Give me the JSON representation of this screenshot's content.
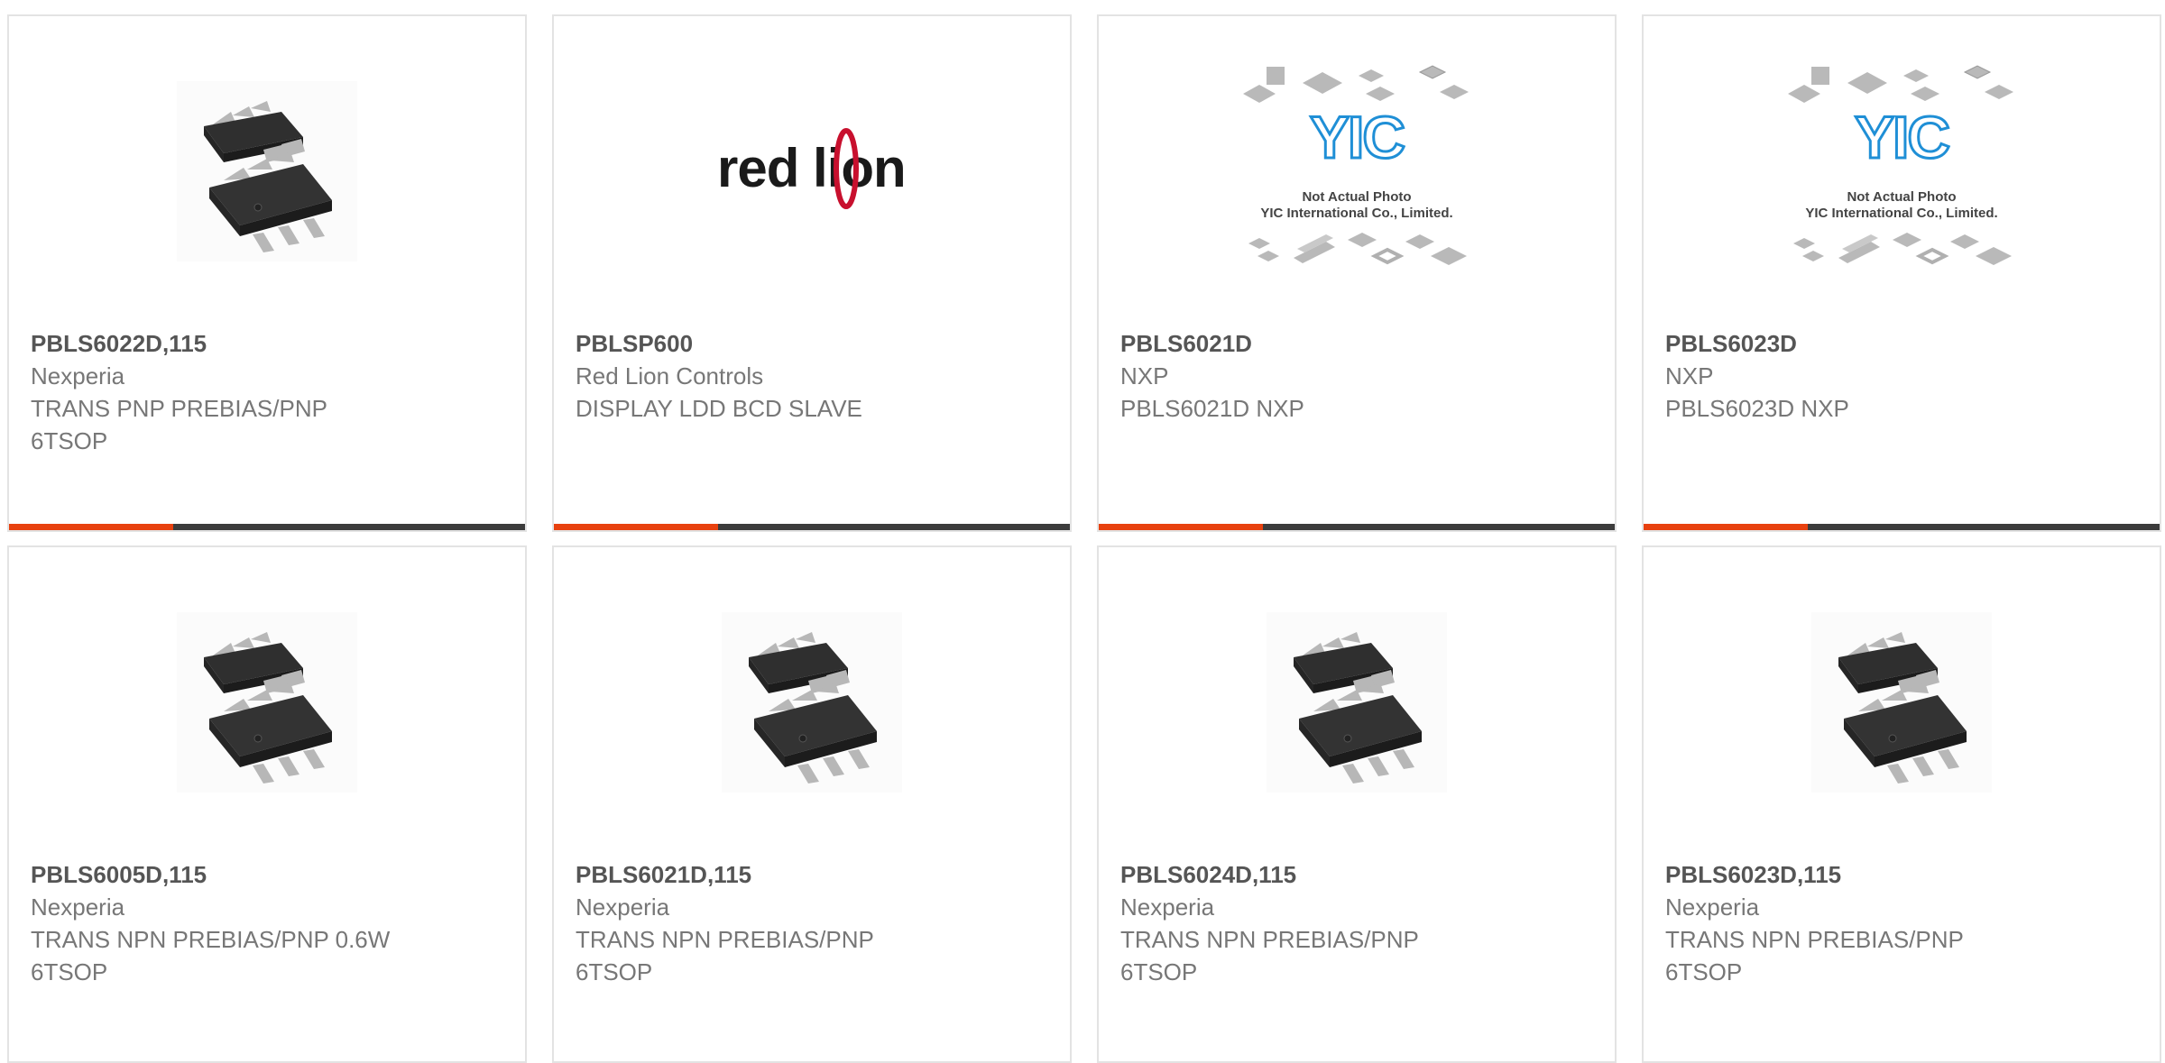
{
  "products": [
    {
      "pn": "PBLS6022D,115",
      "mfr": "Nexperia",
      "desc": "TRANS PNP PREBIAS/PNP 6TSOP",
      "image": "ic-6tsop-icon"
    },
    {
      "pn": "PBLSP600",
      "mfr": "Red Lion Controls",
      "desc": "DISPLAY LDD BCD SLAVE",
      "image": "red-lion-logo"
    },
    {
      "pn": "PBLS6021D",
      "mfr": "NXP",
      "desc": "PBLS6021D NXP",
      "image": "yic-placeholder"
    },
    {
      "pn": "PBLS6023D",
      "mfr": "NXP",
      "desc": "PBLS6023D NXP",
      "image": "yic-placeholder"
    },
    {
      "pn": "PBLS6005D,115",
      "mfr": "Nexperia",
      "desc": "TRANS NPN PREBIAS/PNP 0.6W 6TSOP",
      "image": "ic-6tsop-icon"
    },
    {
      "pn": "PBLS6021D,115",
      "mfr": "Nexperia",
      "desc": "TRANS NPN PREBIAS/PNP 6TSOP",
      "image": "ic-6tsop-icon"
    },
    {
      "pn": "PBLS6024D,115",
      "mfr": "Nexperia",
      "desc": "TRANS NPN PREBIAS/PNP 6TSOP",
      "image": "ic-6tsop-icon"
    },
    {
      "pn": "PBLS6023D,115",
      "mfr": "Nexperia",
      "desc": "TRANS NPN PREBIAS/PNP 6TSOP",
      "image": "ic-6tsop-icon"
    }
  ],
  "logo_text": {
    "red_lion": "red lion",
    "yic_brand": "YIC",
    "yic_line1": "Not Actual Photo",
    "yic_line2": "YIC International Co., Limited."
  },
  "colors": {
    "accent": "#e8410f",
    "bar": "#3c3c3c",
    "border": "#e3e3e3",
    "part": "#555555",
    "text": "#777777"
  }
}
